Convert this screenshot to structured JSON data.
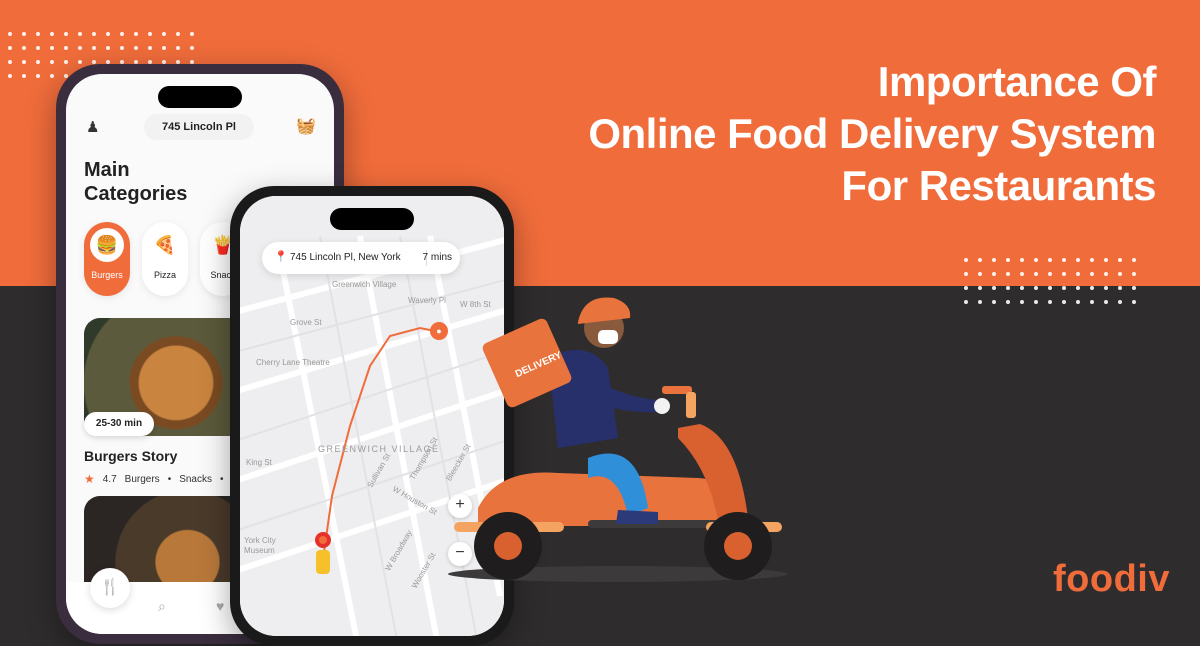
{
  "headline": {
    "line1": "Importance Of",
    "line2": "Online Food Delivery System",
    "line3": "For Restaurants"
  },
  "brand": {
    "logo": "foodiv"
  },
  "colors": {
    "accent": "#f06c3b",
    "dark": "#2f2c2d"
  },
  "phone_app": {
    "location": "745 Lincoln Pl",
    "title_line1": "Main",
    "title_line2": "Categories",
    "categories": [
      {
        "label": "Burgers",
        "icon": "burger-icon"
      },
      {
        "label": "Pizza",
        "icon": "pizza-icon"
      },
      {
        "label": "Snack",
        "icon": "fries-icon"
      }
    ],
    "restaurant": {
      "time": "25-30 min",
      "name": "Burgers Story",
      "rating": "4.7",
      "tags": [
        "Burgers",
        "Snacks",
        "$"
      ]
    }
  },
  "phone_map": {
    "address": "745 Lincoln Pl, New York",
    "eta": "7 mins",
    "district": "GREENWICH VILLAGE",
    "labels": {
      "greenwich_village": "Greenwich Village",
      "grove_st": "Grove St",
      "cherry_lane": "Cherry Lane Theatre",
      "waverly": "Waverly Pl",
      "w8th": "W 8th St",
      "king_st": "King St",
      "sullivan": "Sullivan St",
      "thompson": "Thompson St",
      "bleecker": "Bleecker St",
      "w_houston": "W Houston St",
      "w_broadway": "W Broadway",
      "wooster": "Wooster St",
      "york_city_museum": "York City Museum"
    },
    "zoom_in": "+",
    "zoom_out": "−"
  },
  "illustration": {
    "bag_text": "DELIVERY"
  }
}
